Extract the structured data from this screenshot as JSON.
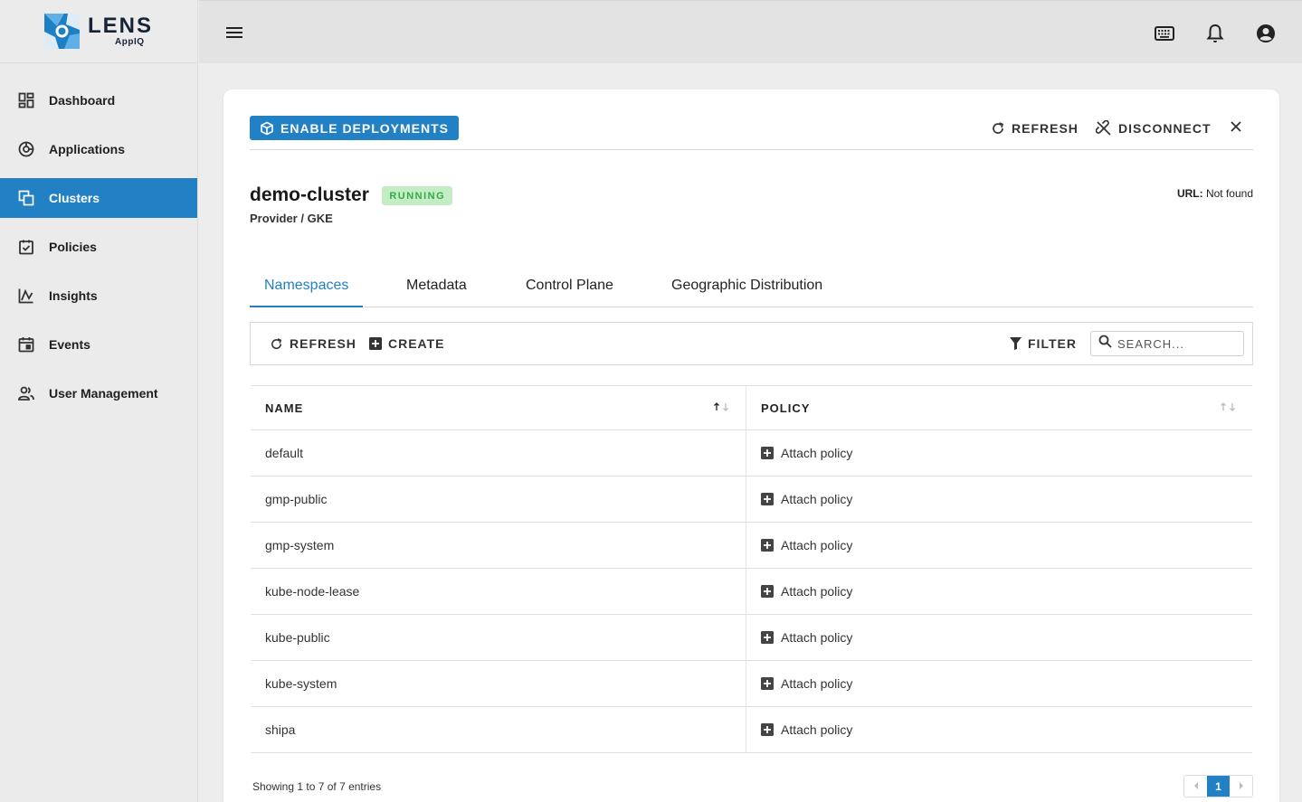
{
  "brand": {
    "title": "LENS",
    "subtitle": "AppIQ",
    "color": "#2280c4"
  },
  "sidebar": {
    "items": [
      {
        "label": "Dashboard",
        "icon": "dashboard-icon"
      },
      {
        "label": "Applications",
        "icon": "applications-icon"
      },
      {
        "label": "Clusters",
        "icon": "clusters-icon",
        "active": true
      },
      {
        "label": "Policies",
        "icon": "policies-icon"
      },
      {
        "label": "Insights",
        "icon": "insights-icon"
      },
      {
        "label": "Events",
        "icon": "events-icon"
      },
      {
        "label": "User Management",
        "icon": "user-management-icon"
      }
    ]
  },
  "topbar": {
    "icons": [
      "menu-icon",
      "keyboard-icon",
      "bell-icon",
      "account-icon"
    ]
  },
  "header": {
    "enable_label": "ENABLE DEPLOYMENTS",
    "refresh_label": "REFRESH",
    "disconnect_label": "DISCONNECT"
  },
  "cluster": {
    "name": "demo-cluster",
    "status": "RUNNING",
    "provider": "Provider / GKE",
    "url_label": "URL:",
    "url_value": "Not found"
  },
  "tabs": [
    "Namespaces",
    "Metadata",
    "Control Plane",
    "Geographic Distribution"
  ],
  "toolbar": {
    "refresh_label": "REFRESH",
    "create_label": "CREATE",
    "filter_label": "FILTER",
    "search_placeholder": "SEARCH..."
  },
  "table": {
    "columns": [
      "NAME",
      "POLICY"
    ],
    "rows": [
      {
        "name": "default",
        "policy": "Attach policy"
      },
      {
        "name": "gmp-public",
        "policy": "Attach policy"
      },
      {
        "name": "gmp-system",
        "policy": "Attach policy"
      },
      {
        "name": "kube-node-lease",
        "policy": "Attach policy"
      },
      {
        "name": "kube-public",
        "policy": "Attach policy"
      },
      {
        "name": "kube-system",
        "policy": "Attach policy"
      },
      {
        "name": "shipa",
        "policy": "Attach policy"
      }
    ]
  },
  "footer": {
    "info": "Showing 1 to 7 of 7 entries",
    "page": "1"
  }
}
